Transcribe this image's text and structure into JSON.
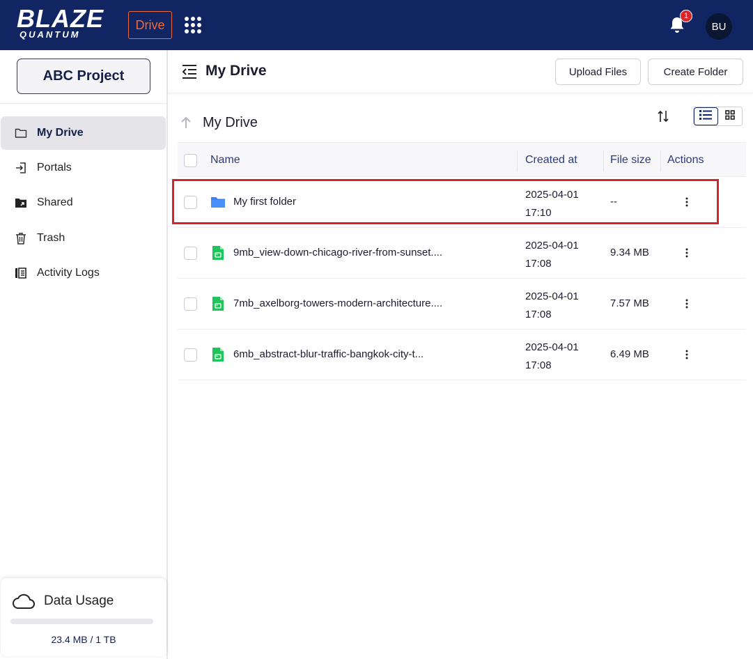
{
  "brand": {
    "logo_main": "BLAZE",
    "logo_sub": "QUANTUM",
    "app_badge": "Drive",
    "notification_count": "1",
    "avatar_initials": "BU",
    "colors": {
      "topbar": "#102561",
      "accent": "#ee6a3a",
      "highlight": "#d8232a",
      "file_green": "#1fc55a",
      "folder_blue": "#3b82f6"
    }
  },
  "sidebar": {
    "project_label": "ABC Project",
    "items": [
      {
        "label": "My Drive",
        "icon": "folder-icon",
        "active": true
      },
      {
        "label": "Portals",
        "icon": "portal-icon",
        "active": false
      },
      {
        "label": "Shared",
        "icon": "shared-folder-icon",
        "active": false
      },
      {
        "label": "Trash",
        "icon": "trash-icon",
        "active": false
      },
      {
        "label": "Activity Logs",
        "icon": "activity-log-icon",
        "active": false
      }
    ],
    "usage": {
      "title": "Data Usage",
      "text": "23.4 MB / 1 TB",
      "fraction": 0.0
    }
  },
  "header": {
    "title": "My Drive",
    "upload_label": "Upload Files",
    "create_folder_label": "Create Folder"
  },
  "breadcrumb": {
    "title": "My Drive"
  },
  "table": {
    "columns": [
      "Name",
      "Created at",
      "File size",
      "Actions"
    ],
    "rows": [
      {
        "type": "folder",
        "name": "My first folder",
        "date": "2025-04-01",
        "time": "17:10",
        "size": "--"
      },
      {
        "type": "image",
        "name": "9mb_view-down-chicago-river-from-sunset....",
        "date": "2025-04-01",
        "time": "17:08",
        "size": "9.34 MB"
      },
      {
        "type": "image",
        "name": "7mb_axelborg-towers-modern-architecture....",
        "date": "2025-04-01",
        "time": "17:08",
        "size": "7.57 MB"
      },
      {
        "type": "image",
        "name": "6mb_abstract-blur-traffic-bangkok-city-t...",
        "date": "2025-04-01",
        "time": "17:08",
        "size": "6.49 MB"
      }
    ]
  }
}
